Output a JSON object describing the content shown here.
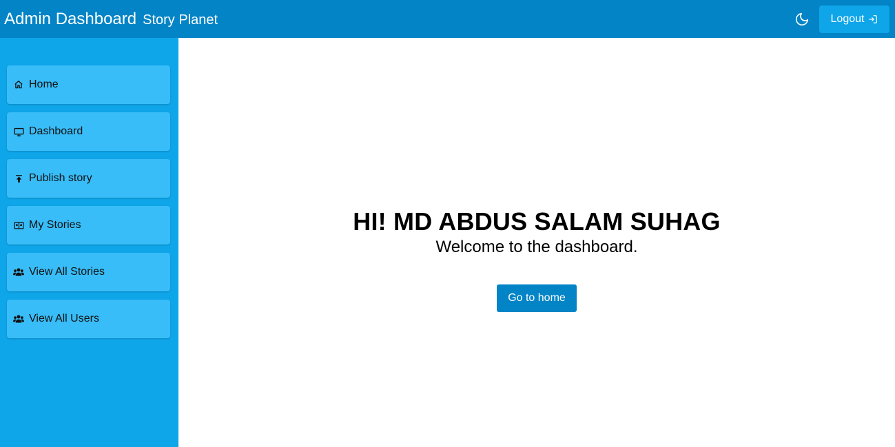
{
  "header": {
    "title": "Admin Dashboard",
    "subtitle": "Story Planet",
    "theme_icon": "moon-icon",
    "logout_label": "Logout",
    "logout_icon": "logout-icon"
  },
  "sidebar": {
    "items": [
      {
        "label": "Home",
        "icon": "home-icon"
      },
      {
        "label": "Dashboard",
        "icon": "monitor-icon"
      },
      {
        "label": "Publish story",
        "icon": "upload-icon"
      },
      {
        "label": "My Stories",
        "icon": "book-icon"
      },
      {
        "label": "View All Stories",
        "icon": "users-icon"
      },
      {
        "label": "View All Users",
        "icon": "users-icon"
      }
    ]
  },
  "main": {
    "greeting": "HI! MD ABDUS SALAM SUHAG",
    "welcome": "Welcome to the dashboard.",
    "home_button": "Go to home"
  },
  "colors": {
    "header_bg": "#0284c7",
    "sidebar_bg": "#0ea5e9",
    "sidebar_item_bg": "#38bdf8",
    "button_bg": "#0284c7",
    "logout_bg": "#0ea5e9"
  }
}
